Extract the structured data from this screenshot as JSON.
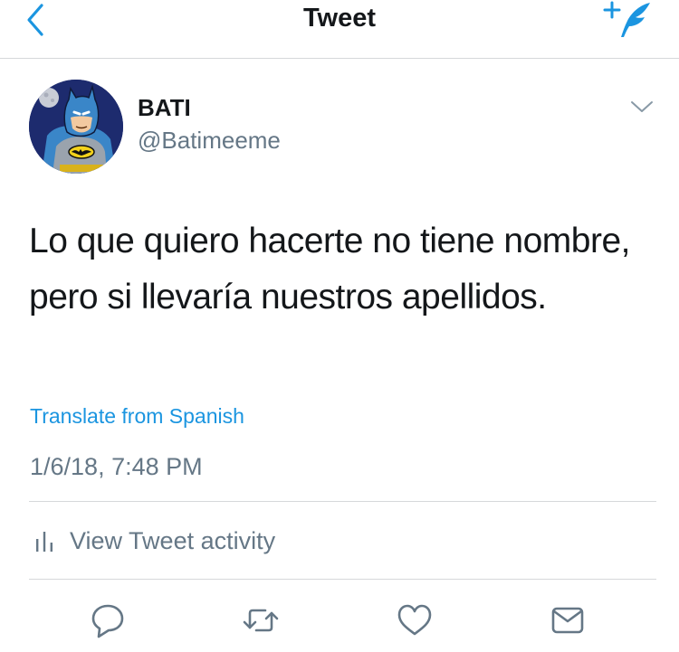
{
  "navbar": {
    "title": "Tweet",
    "back_icon": "chevron-left-icon",
    "compose_icon": "compose-tweet-icon"
  },
  "tweet": {
    "display_name": "BATI",
    "handle": "@Batimeeme",
    "avatar_icon": "batman-avatar",
    "caret_icon": "chevron-down-icon",
    "text": "Lo que quiero hacerte no tiene nombre, pero si llevaría nuestros apellidos.",
    "translate_label": "Translate from Spanish",
    "timestamp": "1/6/18, 7:48 PM"
  },
  "activity": {
    "label": "View Tweet activity",
    "icon": "analytics-bars-icon"
  },
  "actions": [
    {
      "icon": "reply-icon"
    },
    {
      "icon": "retweet-icon"
    },
    {
      "icon": "like-icon"
    },
    {
      "icon": "direct-message-icon"
    }
  ],
  "colors": {
    "accent": "#1b95e0",
    "text": "#14171a",
    "secondary": "#657786",
    "divider": "#d6d8da"
  }
}
